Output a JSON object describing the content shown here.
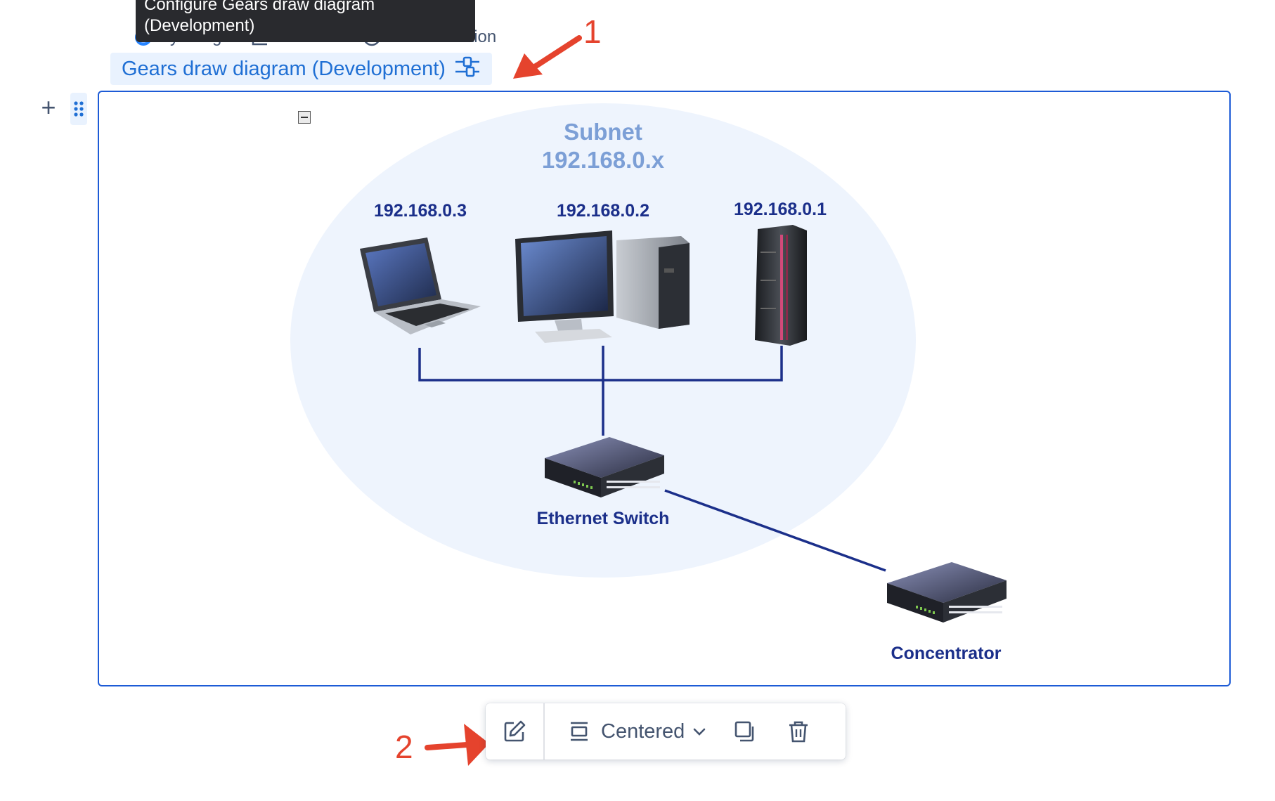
{
  "tooltip": {
    "line1": "Configure Gears draw diagram",
    "line2": "(Development)"
  },
  "meta": {
    "author": "By Zeegue",
    "views": "See views",
    "reaction": "Add a reaction"
  },
  "macro": {
    "title": "Gears draw diagram (Development)"
  },
  "annotations": {
    "first": "1",
    "second": "2"
  },
  "diagram": {
    "subnet_title": "Subnet",
    "subnet_range": "192.168.0.x",
    "devices": [
      {
        "label": "192.168.0.3",
        "icon": "laptop-icon"
      },
      {
        "label": "192.168.0.2",
        "icon": "desktop-computer-icon"
      },
      {
        "label": "192.168.0.1",
        "icon": "server-rack-icon"
      }
    ],
    "switch_label": "Ethernet Switch",
    "concentrator_label": "Concentrator"
  },
  "toolbar": {
    "layout_label": "Centered"
  },
  "colors": {
    "accent": "#1d5bd6",
    "annotation": "#e5432d",
    "link": "#1f6fd4",
    "diagram_text": "#1b2f8a"
  }
}
